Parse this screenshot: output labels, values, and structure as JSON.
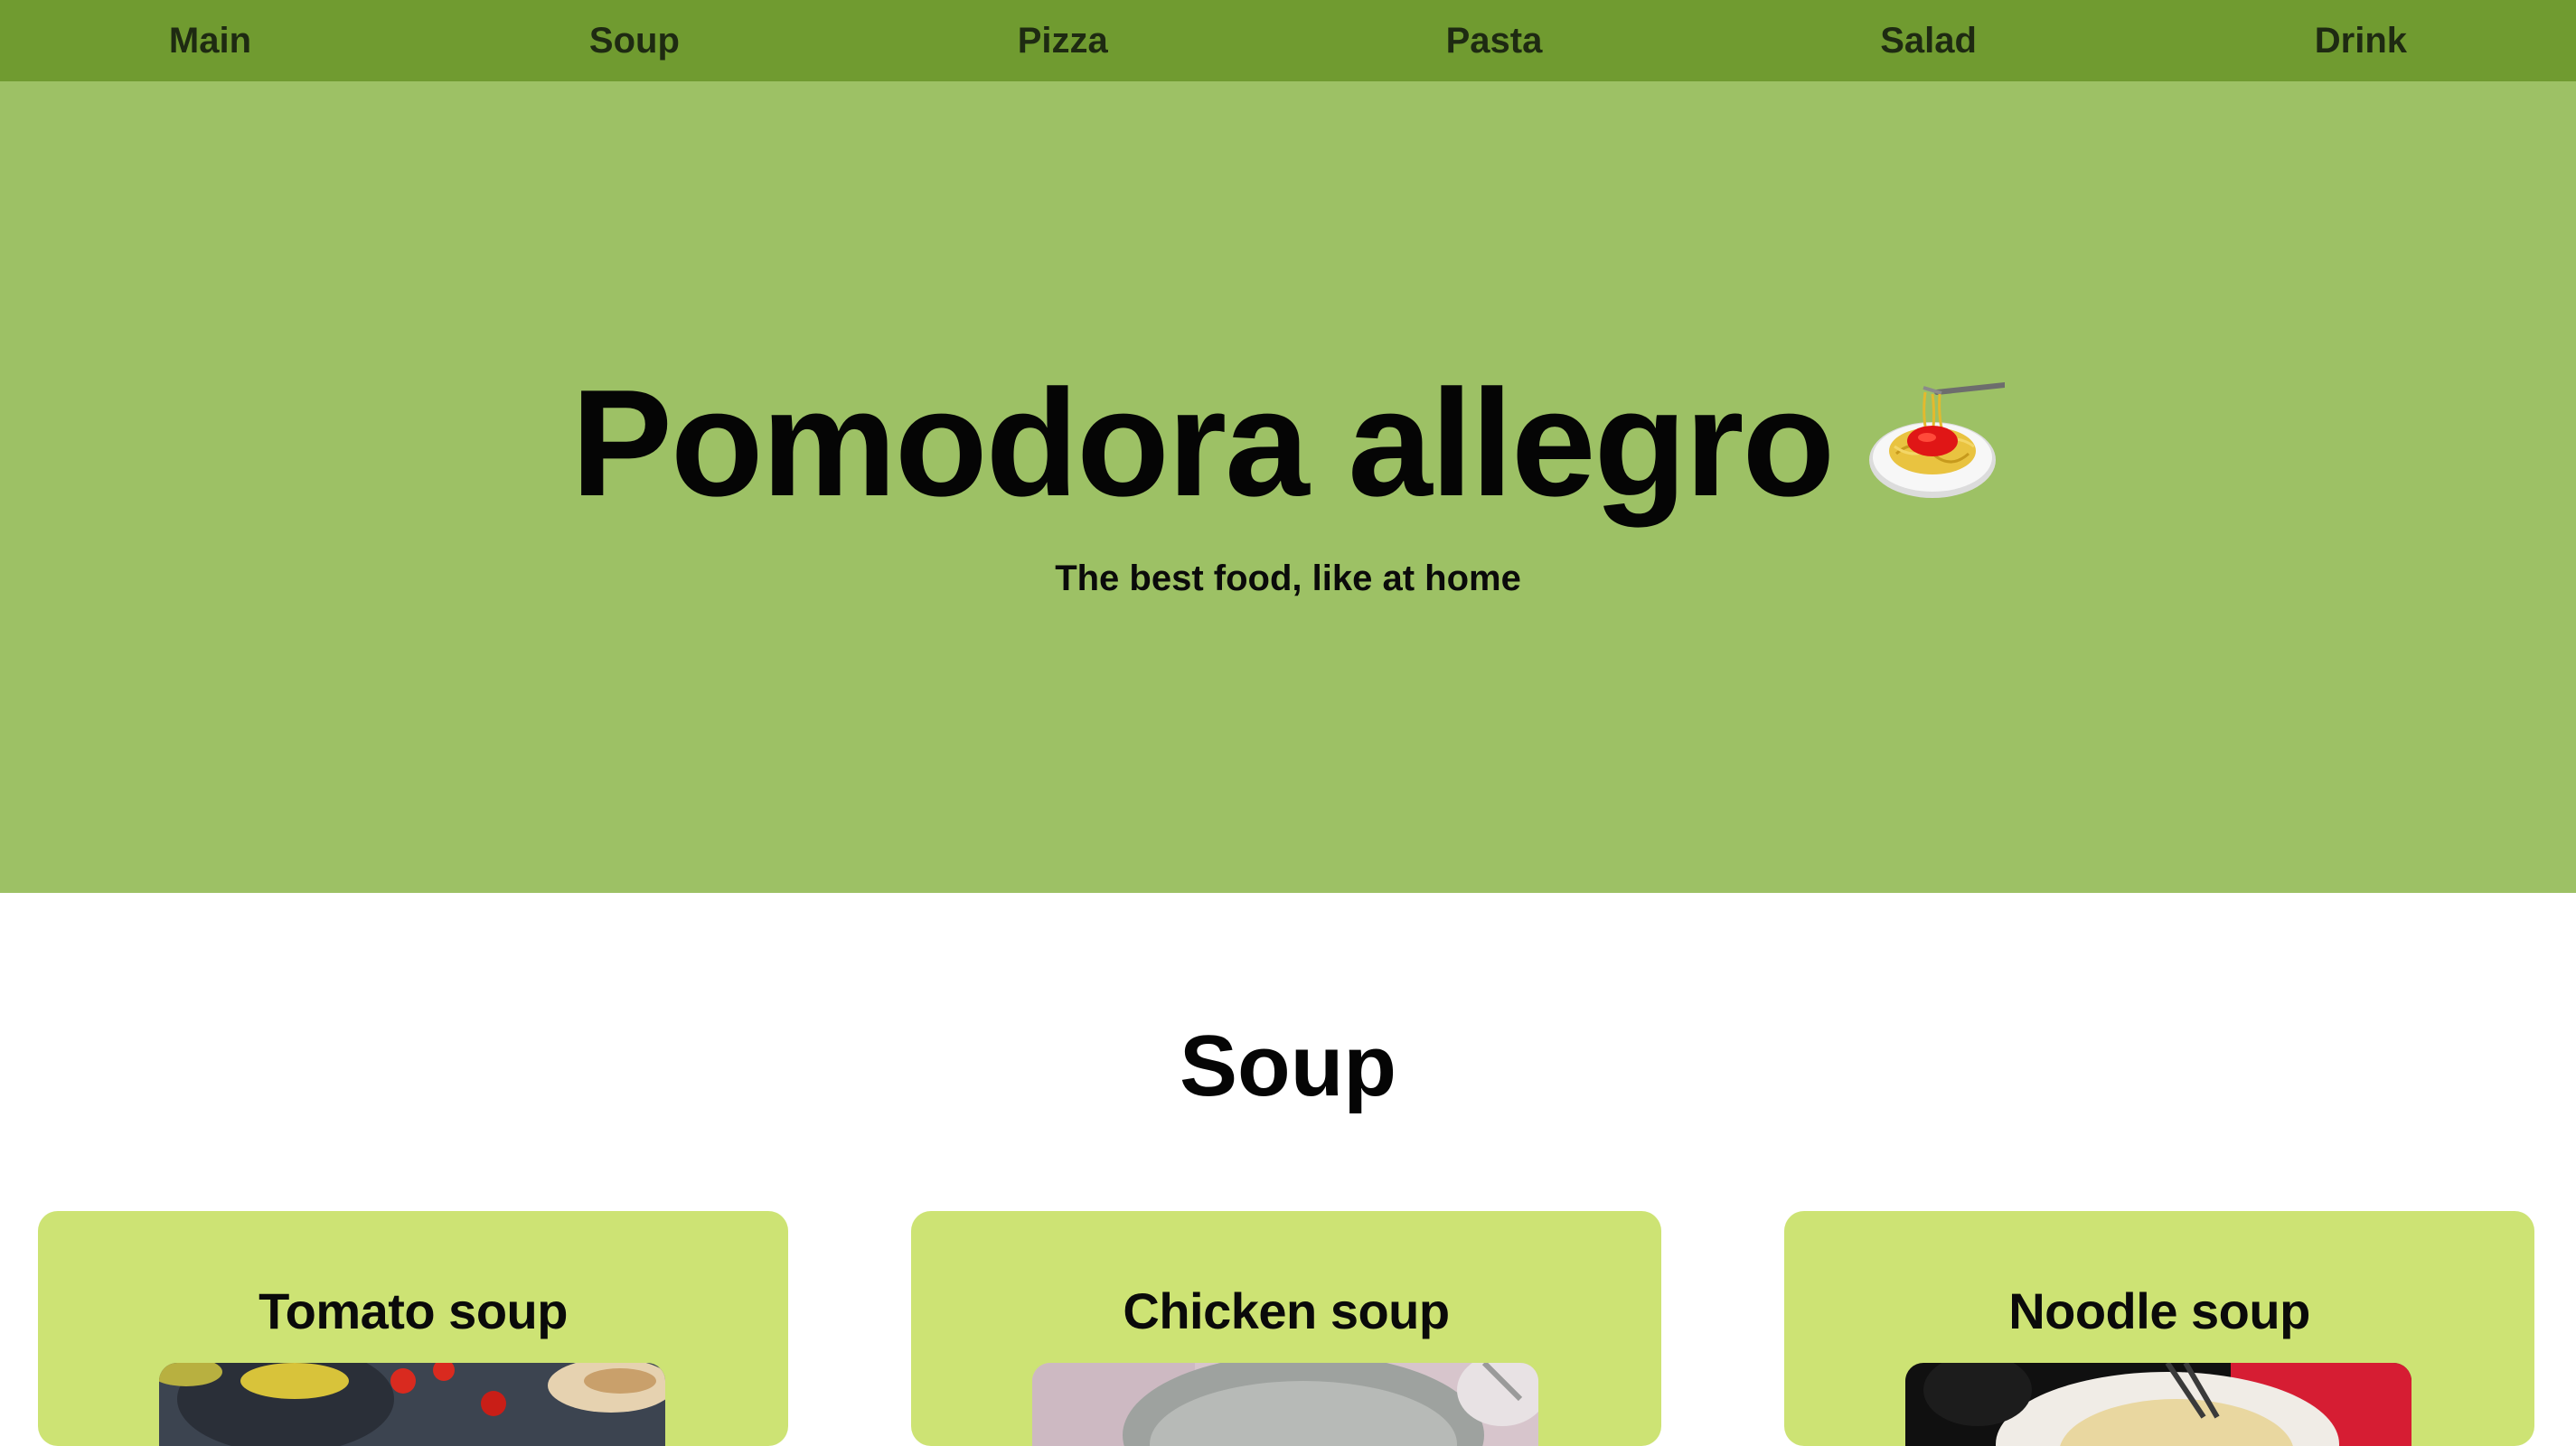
{
  "nav": {
    "items": [
      {
        "label": "Main"
      },
      {
        "label": "Soup"
      },
      {
        "label": "Pizza"
      },
      {
        "label": "Pasta"
      },
      {
        "label": "Salad"
      },
      {
        "label": "Drink"
      }
    ]
  },
  "hero": {
    "title": "Pomodora allegro",
    "icon": "spaghetti-icon",
    "subtitle": "The best food, like at home"
  },
  "section": {
    "title": "Soup",
    "cards": [
      {
        "title": "Tomato soup"
      },
      {
        "title": "Chicken soup"
      },
      {
        "title": "Noodle soup"
      }
    ]
  },
  "colors": {
    "nav_bg": "#709b30",
    "hero_bg": "#9dc165",
    "card_bg": "#cde374"
  }
}
